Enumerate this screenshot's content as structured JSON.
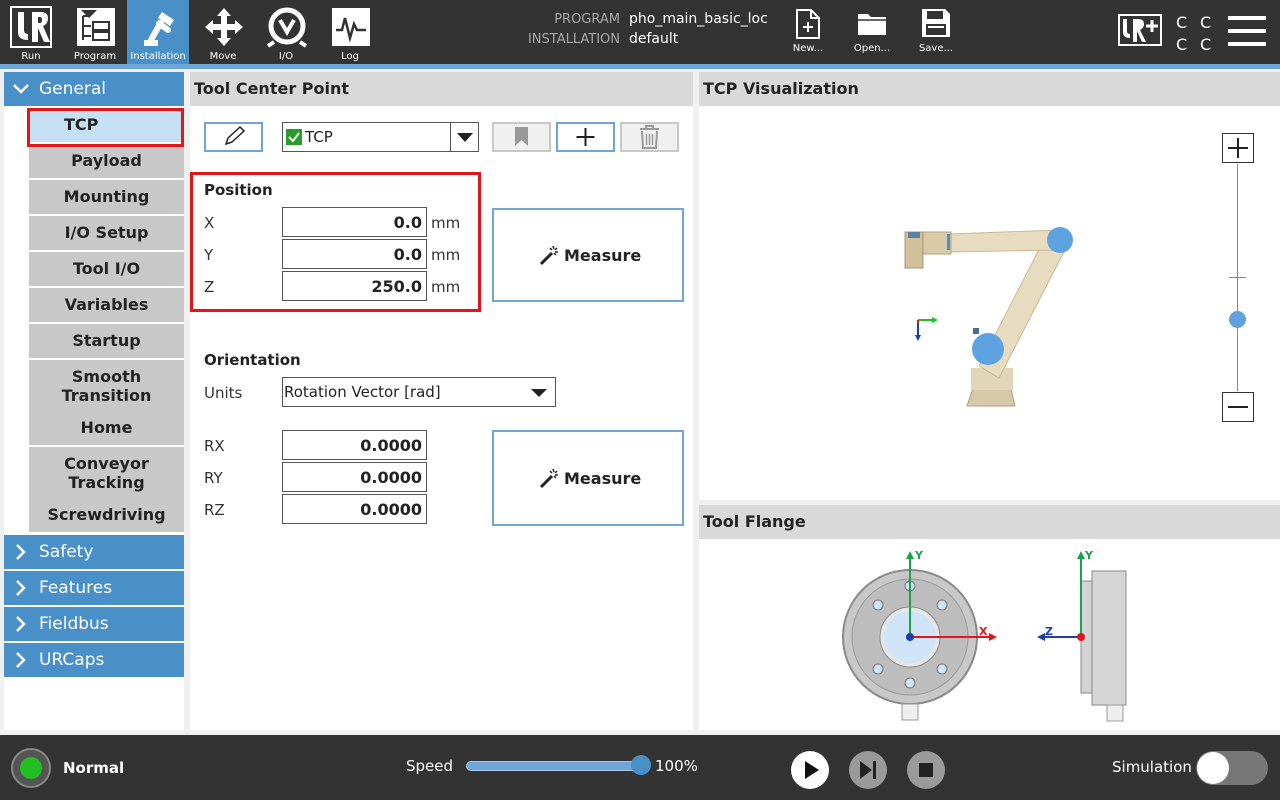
{
  "header": {
    "nav": [
      {
        "label": "Run",
        "icon": "ur-logo-icon"
      },
      {
        "label": "Program",
        "icon": "program-icon"
      },
      {
        "label": "Installation",
        "icon": "installation-icon"
      },
      {
        "label": "Move",
        "icon": "move-icon"
      },
      {
        "label": "I/O",
        "icon": "io-icon"
      },
      {
        "label": "Log",
        "icon": "log-icon"
      }
    ],
    "program_label": "PROGRAM",
    "program_value": "pho_main_basic_loc",
    "installation_label": "INSTALLATION",
    "installation_value": "default",
    "new_label": "New...",
    "open_label": "Open...",
    "save_label": "Save...",
    "cc_text": "CCCC"
  },
  "sidebar": {
    "general": "General",
    "items": [
      "TCP",
      "Payload",
      "Mounting",
      "I/O Setup",
      "Tool I/O",
      "Variables",
      "Startup",
      "Smooth Transition",
      "Home",
      "Conveyor Tracking",
      "Screwdriving"
    ],
    "sections": [
      "Safety",
      "Features",
      "Fieldbus",
      "URCaps"
    ],
    "selected": "TCP"
  },
  "tcp_panel": {
    "title": "Tool Center Point",
    "tcp_name": "TCP",
    "position_label": "Position",
    "x_label": "X",
    "x_value": "0.0",
    "y_label": "Y",
    "y_value": "0.0",
    "z_label": "Z",
    "z_value": "250.0",
    "unit_mm": "mm",
    "measure_label": "Measure",
    "orientation_label": "Orientation",
    "units_label": "Units",
    "units_value": "Rotation Vector [rad]",
    "rx_label": "RX",
    "rx_value": "0.0000",
    "ry_label": "RY",
    "ry_value": "0.0000",
    "rz_label": "RZ",
    "rz_value": "0.0000"
  },
  "viz": {
    "title": "TCP Visualization",
    "zoom_plus": "+",
    "zoom_minus": "−"
  },
  "flange": {
    "title": "Tool Flange",
    "axis_x": "X",
    "axis_y": "Y",
    "axis_y2": "Y",
    "axis_z": "Z"
  },
  "footer": {
    "status": "Normal",
    "speed_label": "Speed",
    "speed_value": "100%",
    "speed_fraction": 1.0,
    "simulation_label": "Simulation"
  },
  "colors": {
    "accent": "#4a90c8",
    "highlight": "#e0161d",
    "status_ok": "#21c021"
  }
}
